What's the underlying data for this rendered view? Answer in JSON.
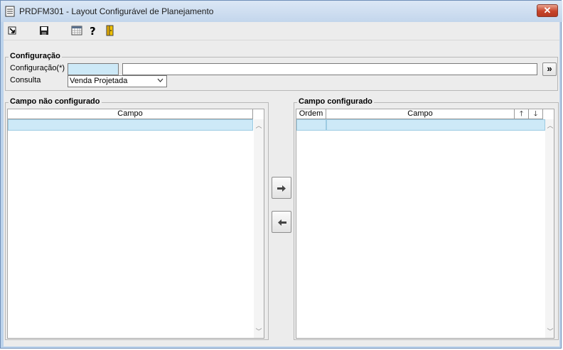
{
  "window": {
    "title": "PRDFM301 - Layout Configurável de Planejamento",
    "close_symbol": "✕"
  },
  "toolbar": {
    "icons": [
      "exit-icon",
      "save-icon",
      "calendar-icon",
      "help-icon",
      "door-icon"
    ]
  },
  "configuracao": {
    "group_label": "Configuração",
    "field_label": "Configuração(*)",
    "code_value": "",
    "description_value": "",
    "lookup_button": "»",
    "consulta_label": "Consulta",
    "consulta_value": "Venda Projetada"
  },
  "left_panel": {
    "label": "Campo não configurado",
    "column": "Campo"
  },
  "right_panel": {
    "label": "Campo configurado",
    "col_ordem": "Ordem",
    "col_campo": "Campo",
    "up_symbol": "🡑",
    "down_symbol": "🡓"
  },
  "colors": {
    "titlebar": "#c3d6ec",
    "selection": "#cde9f7",
    "close": "#c7442a"
  }
}
